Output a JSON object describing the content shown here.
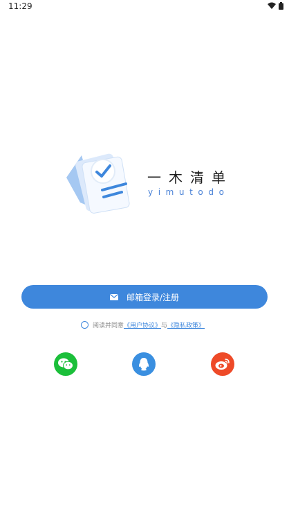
{
  "status_bar": {
    "time": "11:29"
  },
  "app": {
    "title": "一木清单",
    "subtitle": "yimutodo"
  },
  "login": {
    "email_button_label": "邮箱登录/注册"
  },
  "agreement": {
    "prefix": "阅读并同意",
    "user_agreement": "《用户协议》",
    "connector": "与",
    "privacy_policy": "《隐私政策》"
  },
  "social_logins": [
    {
      "name": "wechat-icon",
      "color": "#1bbf3a"
    },
    {
      "name": "qq-icon",
      "color": "#3a8fe0"
    },
    {
      "name": "weibo-icon",
      "color": "#ee4a28"
    }
  ],
  "colors": {
    "accent": "#3e87dc",
    "subtitle": "#4a82d6"
  }
}
